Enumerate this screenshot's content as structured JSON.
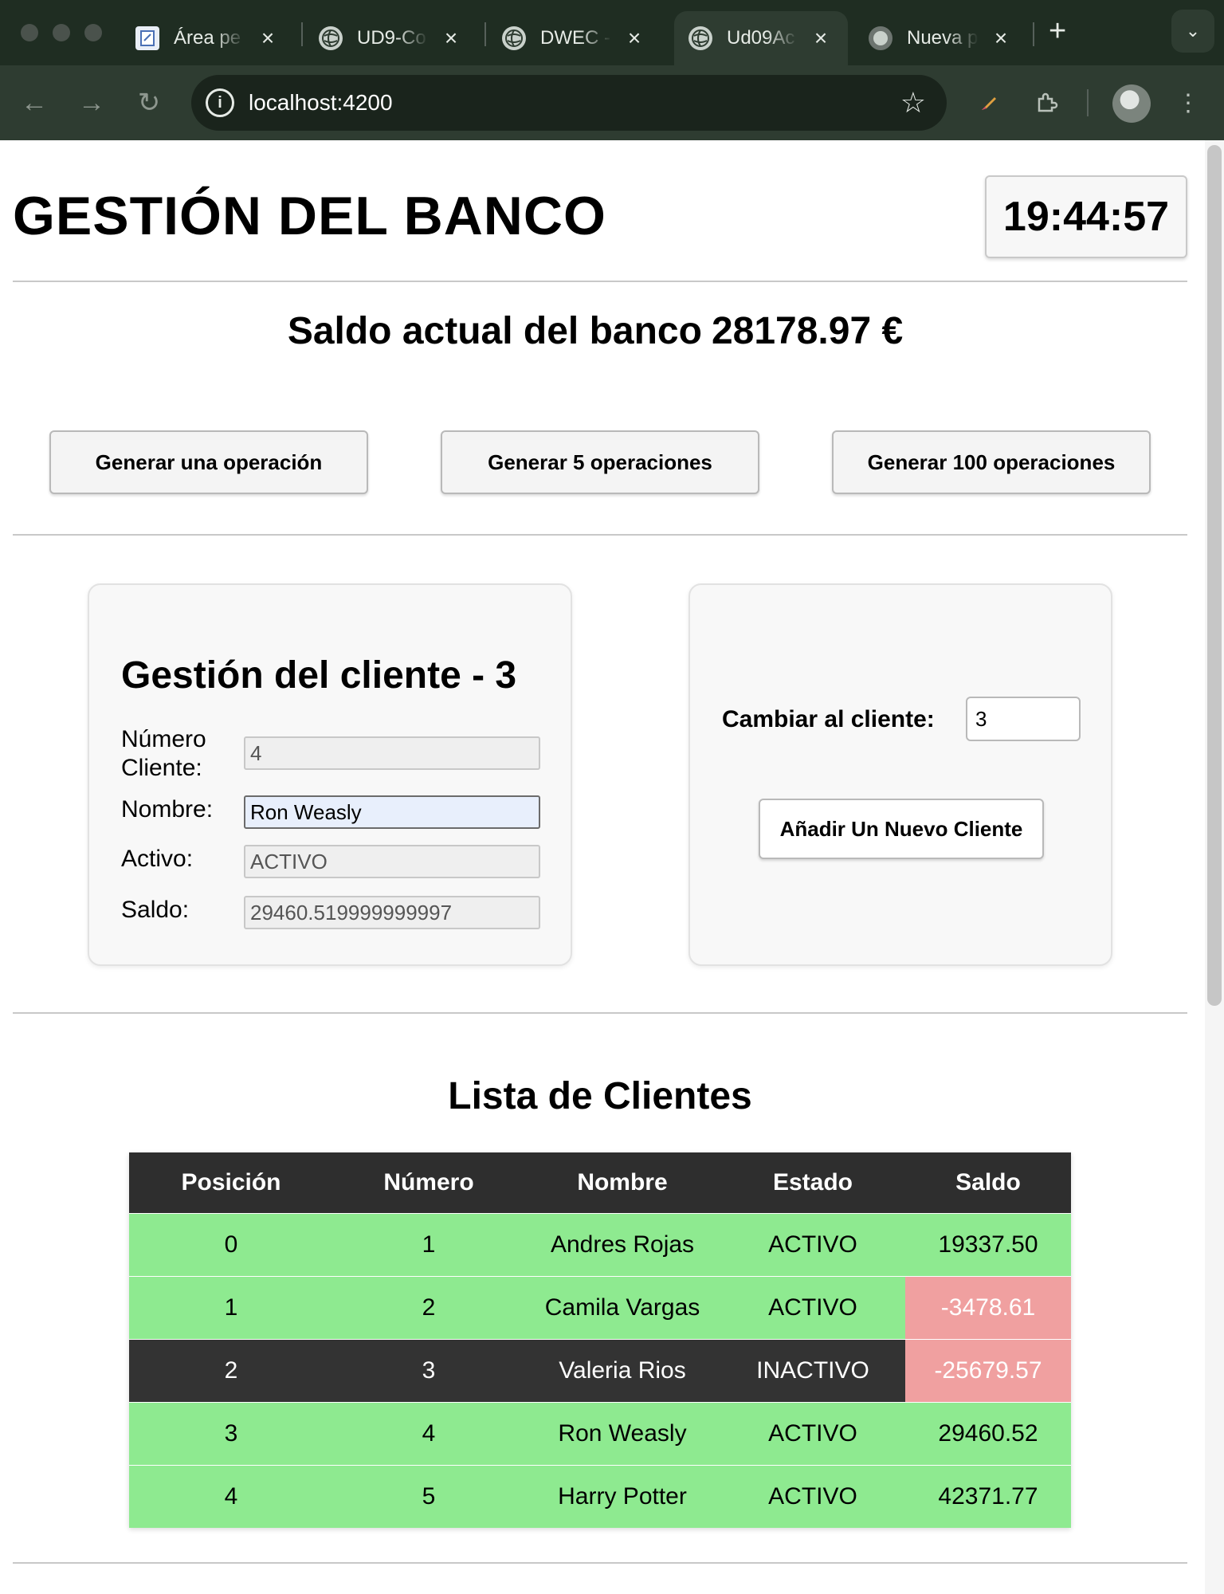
{
  "browser": {
    "tabs": [
      {
        "title": "Área pe",
        "icon": "document-icon",
        "active": false
      },
      {
        "title": "UD9-Co",
        "icon": "globe-icon",
        "active": false
      },
      {
        "title": "DWEC -",
        "icon": "globe-icon",
        "active": false
      },
      {
        "title": "Ud09Ac",
        "icon": "globe-icon",
        "active": true
      },
      {
        "title": "Nueva p",
        "icon": "chrome-icon",
        "active": false
      }
    ],
    "url": "localhost:4200"
  },
  "header": {
    "title": "GESTIÓN DEL BANCO",
    "clock": "19:44:57"
  },
  "balance": {
    "label": "Saldo actual del banco",
    "amount": "28178.97 €"
  },
  "operations": {
    "one": "Generar una operación",
    "five": "Generar 5 operaciones",
    "hundred": "Generar 100 operaciones"
  },
  "client_card": {
    "title": "Gestión del cliente - 3",
    "numero_label": "Número Cliente:",
    "numero_value": "4",
    "nombre_label": "Nombre:",
    "nombre_value": "Ron Weasly",
    "activo_label": "Activo:",
    "activo_value": "ACTIVO",
    "saldo_label": "Saldo:",
    "saldo_value": "29460.519999999997"
  },
  "switch_card": {
    "label": "Cambiar al cliente:",
    "value": "3",
    "add_button": "Añadir Un Nuevo Cliente"
  },
  "client_list": {
    "title": "Lista de Clientes",
    "columns": [
      "Posición",
      "Número",
      "Nombre",
      "Estado",
      "Saldo"
    ],
    "rows": [
      {
        "posicion": "0",
        "numero": "1",
        "nombre": "Andres Rojas",
        "estado": "ACTIVO",
        "saldo": "19337.50",
        "active": true,
        "negative": false
      },
      {
        "posicion": "1",
        "numero": "2",
        "nombre": "Camila Vargas",
        "estado": "ACTIVO",
        "saldo": "-3478.61",
        "active": true,
        "negative": true
      },
      {
        "posicion": "2",
        "numero": "3",
        "nombre": "Valeria Rios",
        "estado": "INACTIVO",
        "saldo": "-25679.57",
        "active": false,
        "negative": true
      },
      {
        "posicion": "3",
        "numero": "4",
        "nombre": "Ron Weasly",
        "estado": "ACTIVO",
        "saldo": "29460.52",
        "active": true,
        "negative": false
      },
      {
        "posicion": "4",
        "numero": "5",
        "nombre": "Harry Potter",
        "estado": "ACTIVO",
        "saldo": "42371.77",
        "active": true,
        "negative": false
      }
    ]
  },
  "colors": {
    "active_row": "#8eea90",
    "inactive_row": "#333333",
    "negative_cell": "#f0a0a0",
    "table_header": "#2e2e2e"
  }
}
